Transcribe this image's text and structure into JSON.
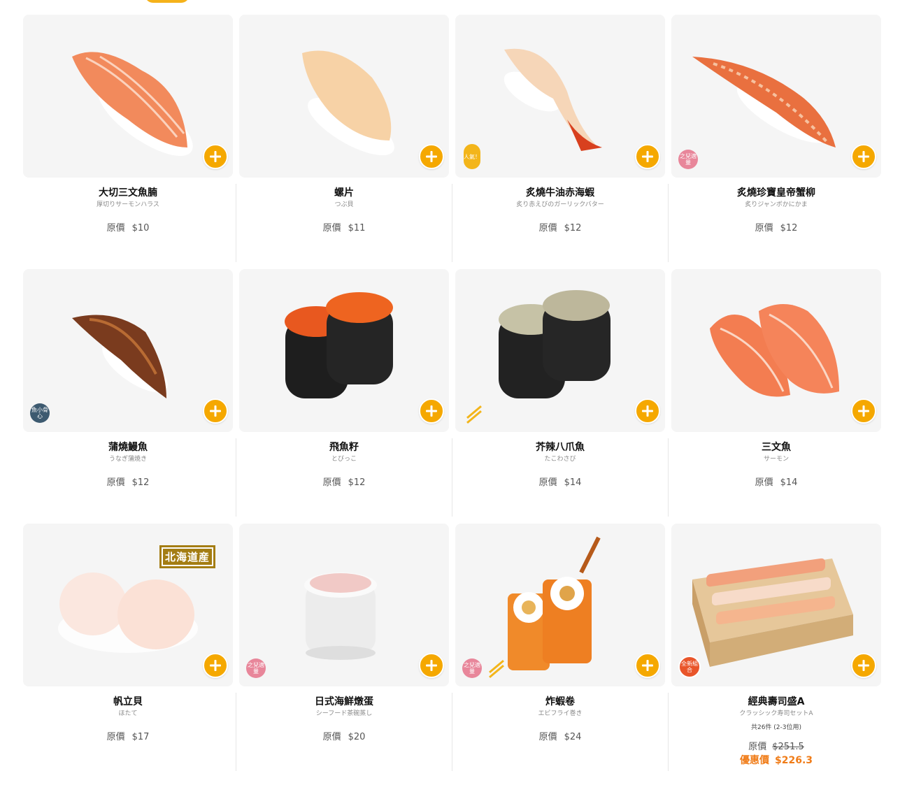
{
  "currency": "$",
  "items": [
    {
      "name": "大切三文魚腩",
      "sub": "厚切りサーモンハラス",
      "price_label": "原價",
      "price": "$10"
    },
    {
      "name": "螺片",
      "sub": "つぶ貝",
      "price_label": "原價",
      "price": "$11"
    },
    {
      "name": "炙燒牛油赤海蝦",
      "sub": "炙り赤えびのガーリックバター",
      "price_label": "原價",
      "price": "$12",
      "badge": "人氣！"
    },
    {
      "name": "炙燒珍寶皇帝蟹柳",
      "sub": "炙りジャンボかにかま",
      "price_label": "原價",
      "price": "$12",
      "badge": "之兒適量"
    },
    {
      "name": "蒲燒鰻魚",
      "sub": "うなぎ蒲焼き",
      "price_label": "原價",
      "price": "$12",
      "badge": "魚小骨心"
    },
    {
      "name": "飛魚籽",
      "sub": "とびっこ",
      "price_label": "原價",
      "price": "$12"
    },
    {
      "name": "芥辣八爪魚",
      "sub": "たこわさび",
      "price_label": "原價",
      "price": "$14"
    },
    {
      "name": "三文魚",
      "sub": "サーモン",
      "price_label": "原價",
      "price": "$14"
    },
    {
      "name": "帆立貝",
      "sub": "ほたて",
      "price_label": "原價",
      "price": "$17",
      "tag": "北海道産"
    },
    {
      "name": "日式海鮮燉蛋",
      "sub": "シーフード茶碗蒸し",
      "price_label": "原價",
      "price": "$20",
      "badge": "之兒適量"
    },
    {
      "name": "炸蝦卷",
      "sub": "エビフライ巻き",
      "price_label": "原價",
      "price": "$24",
      "badge": "之兒適量"
    },
    {
      "name": "經典壽司盛A",
      "sub": "クラッシック寿司セットA",
      "count": "共26件 (2-3位用)",
      "price_label": "原價",
      "price": "$251.5",
      "promo_label": "優惠價",
      "promo_price": "$226.3",
      "badge": "全新組合"
    }
  ],
  "colors": {
    "accent": "#f5a800",
    "promo": "#f07c18",
    "kids_badge": "#e8869a",
    "new_badge": "#e9552a"
  }
}
